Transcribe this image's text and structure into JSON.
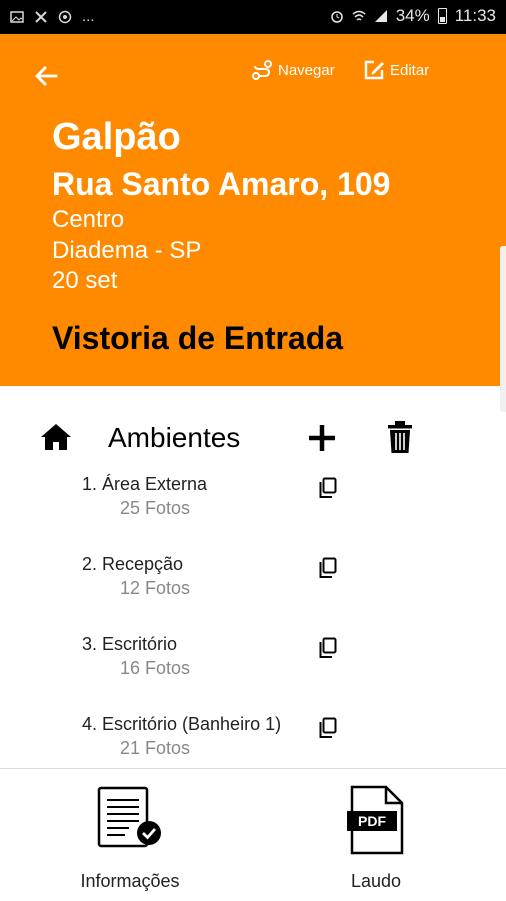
{
  "status_bar": {
    "battery_percent": "34%",
    "time": "11:33",
    "overflow_indicator": "..."
  },
  "header": {
    "navegar_label": "Navegar",
    "editar_label": "Editar",
    "title": "Galpão",
    "street": "Rua Santo Amaro, 109",
    "bairro": "Centro",
    "cidade": "Diadema - SP",
    "data": "20 set",
    "vistoria": "Vistoria de Entrada",
    "background_color": "#ff8a00"
  },
  "ambientes": {
    "title": "Ambientes",
    "items": [
      {
        "name": "1. Área Externa",
        "count": "25 Fotos"
      },
      {
        "name": "2. Recepção",
        "count": "12 Fotos"
      },
      {
        "name": "3. Escritório",
        "count": "16 Fotos"
      },
      {
        "name": "4. Escritório (Banheiro 1)",
        "count": "21 Fotos"
      }
    ]
  },
  "bottom_tabs": {
    "info_label": "Informações",
    "laudo_label": "Laudo",
    "pdf_text": "PDF"
  }
}
